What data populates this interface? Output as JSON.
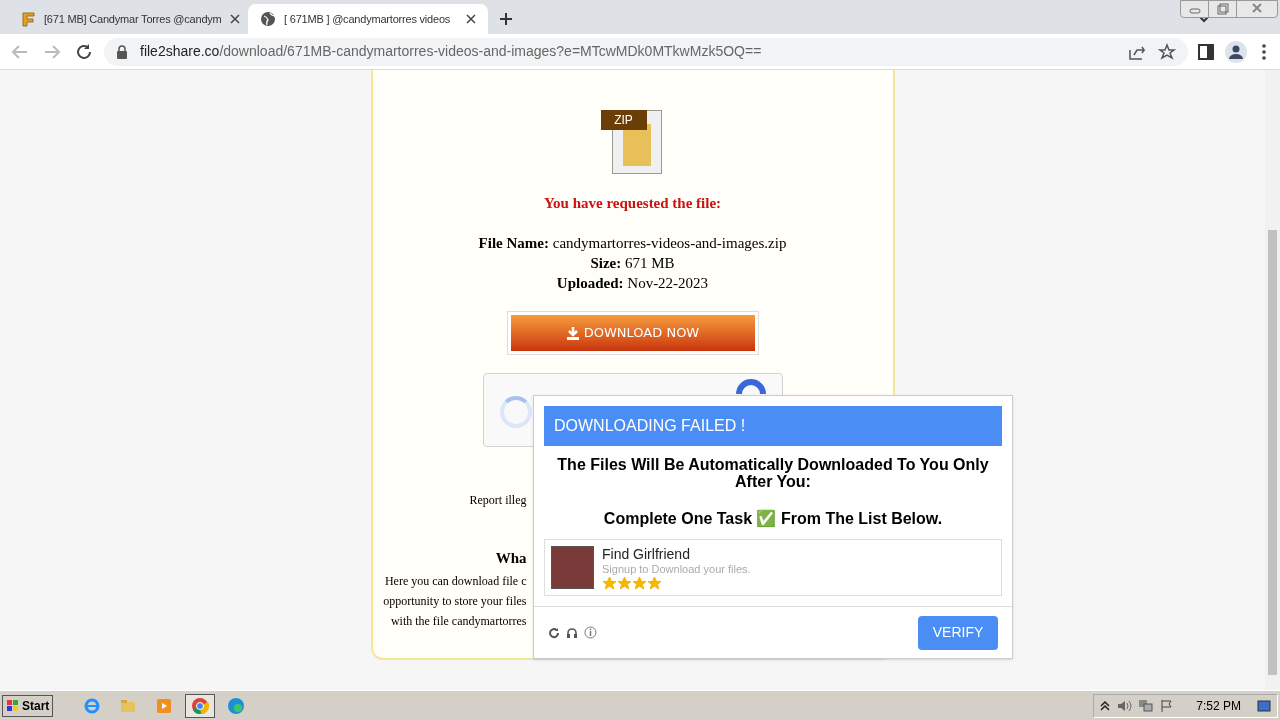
{
  "browser": {
    "tabs": [
      {
        "title": "[671 MB] Candymar Torres @candym",
        "selected": false
      },
      {
        "title": "[ 671MB ] @candymartorres videos",
        "selected": true
      }
    ],
    "address": {
      "domain": "file2share.co",
      "path": "/download/671MB-candymartorres-videos-and-images?e=MTcwMDk0MTkwMzk5OQ=="
    }
  },
  "page": {
    "requested": "You have requested the file:",
    "details": [
      {
        "label": "File Name:",
        "value": "candymartorres-videos-and-images.zip"
      },
      {
        "label": "Size:",
        "value": "671 MB"
      },
      {
        "label": "Uploaded:",
        "value": "Nov-22-2023"
      }
    ],
    "zip_label": "ZIP",
    "download_button": "DOWNLOAD NOW",
    "report_text": "Report illeg",
    "what_heading": "Wha",
    "paragraph_lines": [
      "Here you can download file c",
      "opportunity to store your files",
      "with the file candymartorres"
    ]
  },
  "popup": {
    "title": "DOWNLOADING FAILED !",
    "message": "The Files Will Be Automatically Downloaded To You Only After You:",
    "instruction": "Complete One Task ✅ From The List Below.",
    "offers": [
      {
        "title": "Find Girlfriend",
        "subtitle": "Signup to Download your files.",
        "stars": 4
      }
    ],
    "verify_button": "VERIFY"
  },
  "taskbar": {
    "start": "Start",
    "apps": [
      {
        "kind": "ie",
        "active": false
      },
      {
        "kind": "folder",
        "active": false
      },
      {
        "kind": "media",
        "active": false
      },
      {
        "kind": "chrome",
        "active": true
      },
      {
        "kind": "edge",
        "active": false
      }
    ],
    "clock": "7:52 PM"
  }
}
